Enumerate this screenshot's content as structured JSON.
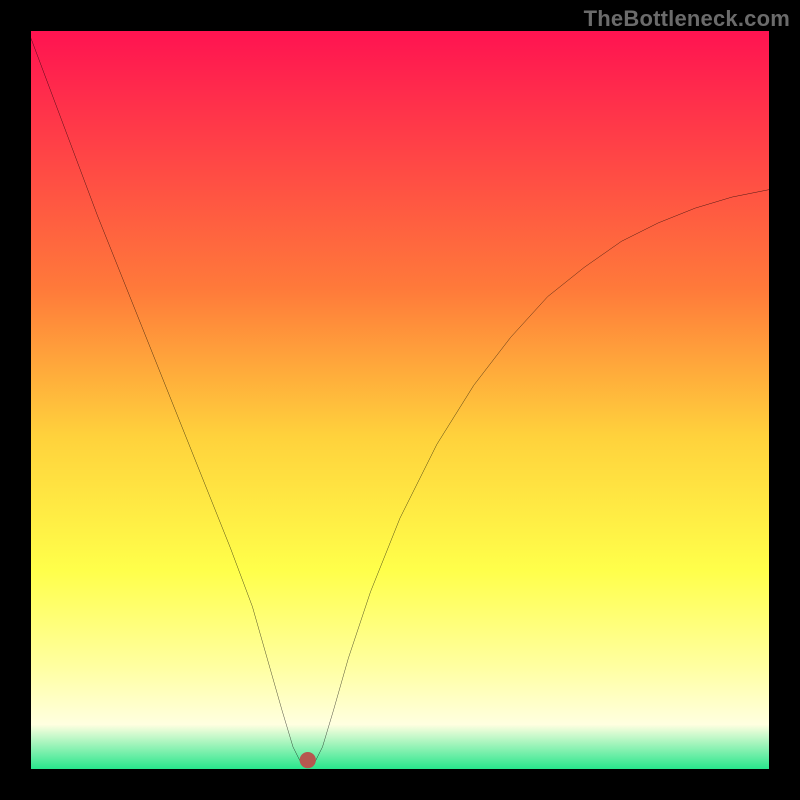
{
  "watermark": "TheBottleneck.com",
  "chart_data": {
    "type": "line",
    "title": "",
    "xlabel": "",
    "ylabel": "",
    "xlim": [
      0,
      100
    ],
    "ylim": [
      0,
      100
    ],
    "background_gradient_stops": [
      {
        "pos": 0.0,
        "color": "#ff1351"
      },
      {
        "pos": 0.35,
        "color": "#ff7a3a"
      },
      {
        "pos": 0.55,
        "color": "#ffd23c"
      },
      {
        "pos": 0.73,
        "color": "#ffff4a"
      },
      {
        "pos": 0.86,
        "color": "#ffffa0"
      },
      {
        "pos": 0.94,
        "color": "#ffffe0"
      },
      {
        "pos": 1.0,
        "color": "#28e68c"
      }
    ],
    "marker": {
      "x": 37.5,
      "y": 1.2,
      "color": "#b6574f",
      "r": 1.1
    },
    "curve": {
      "comment": "y is bottleneck percentage (100=worst at top, 0=best at bottom). x is some scanning parameter. Curve has a sharp minimum near x≈37 and rises on both sides; right branch saturates toward ~78.",
      "points": [
        {
          "x": 0.0,
          "y": 99.0
        },
        {
          "x": 3.0,
          "y": 91.0
        },
        {
          "x": 6.0,
          "y": 83.0
        },
        {
          "x": 9.0,
          "y": 75.0
        },
        {
          "x": 12.0,
          "y": 67.5
        },
        {
          "x": 15.0,
          "y": 60.0
        },
        {
          "x": 18.0,
          "y": 52.5
        },
        {
          "x": 21.0,
          "y": 45.0
        },
        {
          "x": 24.0,
          "y": 37.5
        },
        {
          "x": 27.0,
          "y": 30.0
        },
        {
          "x": 30.0,
          "y": 22.0
        },
        {
          "x": 32.0,
          "y": 15.0
        },
        {
          "x": 34.0,
          "y": 8.0
        },
        {
          "x": 35.5,
          "y": 3.0
        },
        {
          "x": 36.5,
          "y": 1.0
        },
        {
          "x": 37.5,
          "y": 0.5
        },
        {
          "x": 38.5,
          "y": 1.0
        },
        {
          "x": 39.5,
          "y": 3.0
        },
        {
          "x": 41.0,
          "y": 8.0
        },
        {
          "x": 43.0,
          "y": 15.0
        },
        {
          "x": 46.0,
          "y": 24.0
        },
        {
          "x": 50.0,
          "y": 34.0
        },
        {
          "x": 55.0,
          "y": 44.0
        },
        {
          "x": 60.0,
          "y": 52.0
        },
        {
          "x": 65.0,
          "y": 58.5
        },
        {
          "x": 70.0,
          "y": 64.0
        },
        {
          "x": 75.0,
          "y": 68.0
        },
        {
          "x": 80.0,
          "y": 71.5
        },
        {
          "x": 85.0,
          "y": 74.0
        },
        {
          "x": 90.0,
          "y": 76.0
        },
        {
          "x": 95.0,
          "y": 77.5
        },
        {
          "x": 100.0,
          "y": 78.5
        }
      ]
    }
  }
}
